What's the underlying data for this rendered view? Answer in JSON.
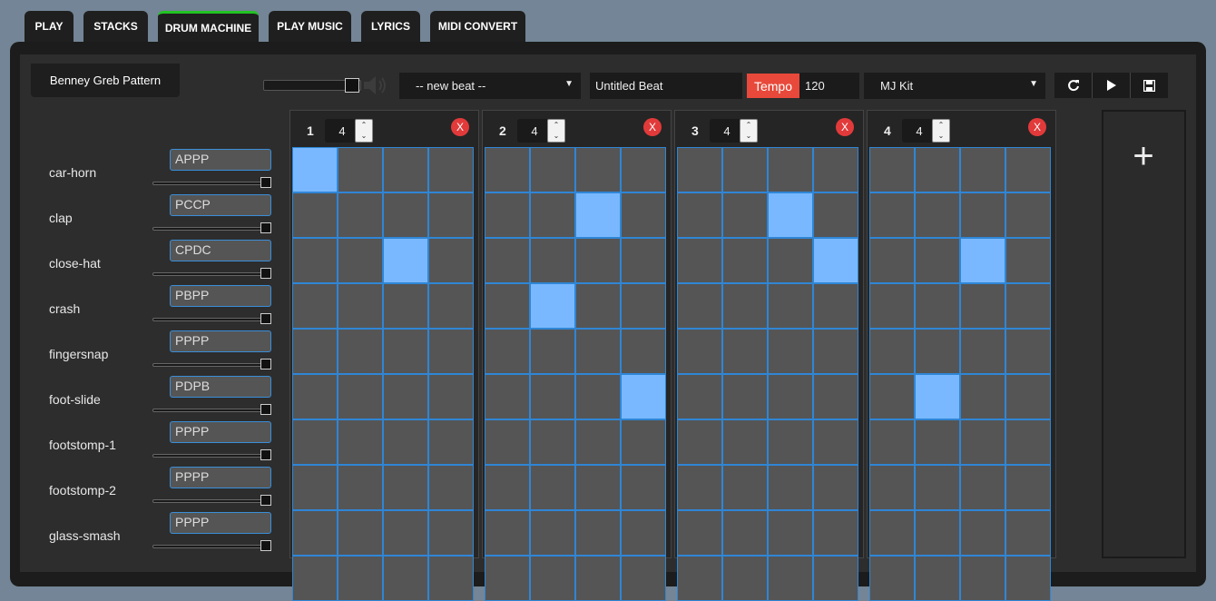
{
  "tabs": [
    "PLAY",
    "STACKS",
    "DRUM MACHINE",
    "PLAY MUSIC",
    "LYRICS",
    "MIDI CONVERT"
  ],
  "active_tab": "DRUM MACHINE",
  "pattern_title": "Benney Greb Pattern",
  "volume": 0.85,
  "beat_select": "-- new beat --",
  "beat_name": "Untitled Beat",
  "tempo_label": "Tempo",
  "tempo_value": "120",
  "kit_select": "MJ Kit",
  "toolbar_icons": [
    "refresh-icon",
    "play-icon",
    "save-icon"
  ],
  "tracks": [
    {
      "name": "car-horn",
      "code": "APPP"
    },
    {
      "name": "clap",
      "code": "PCCP"
    },
    {
      "name": "close-hat",
      "code": "CPDC"
    },
    {
      "name": "crash",
      "code": "PBPP"
    },
    {
      "name": "fingersnap",
      "code": "PPPP"
    },
    {
      "name": "foot-slide",
      "code": "PDPB"
    },
    {
      "name": "footstomp-1",
      "code": "PPPP"
    },
    {
      "name": "footstomp-2",
      "code": "PPPP"
    },
    {
      "name": "glass-smash",
      "code": "PPPP"
    }
  ],
  "measures": [
    {
      "number": "1",
      "beats": "4",
      "delete_label": "X"
    },
    {
      "number": "2",
      "beats": "4",
      "delete_label": "X"
    },
    {
      "number": "3",
      "beats": "4",
      "delete_label": "X"
    },
    {
      "number": "4",
      "beats": "4",
      "delete_label": "X"
    }
  ],
  "active_steps": [
    {
      "track": 0,
      "measure": 0,
      "step": 0
    },
    {
      "track": 2,
      "measure": 0,
      "step": 2
    },
    {
      "track": 1,
      "measure": 1,
      "step": 2
    },
    {
      "track": 3,
      "measure": 1,
      "step": 1
    },
    {
      "track": 5,
      "measure": 1,
      "step": 3
    },
    {
      "track": 1,
      "measure": 2,
      "step": 2
    },
    {
      "track": 2,
      "measure": 2,
      "step": 3
    },
    {
      "track": 2,
      "measure": 3,
      "step": 2
    },
    {
      "track": 5,
      "measure": 3,
      "step": 1
    }
  ],
  "add_measure_label": "+",
  "colors": {
    "accent": "#22c322",
    "tempo": "#e8493a",
    "cell_on": "#79b8ff",
    "cell_border": "#2f86d6",
    "delete": "#e23a3a"
  }
}
